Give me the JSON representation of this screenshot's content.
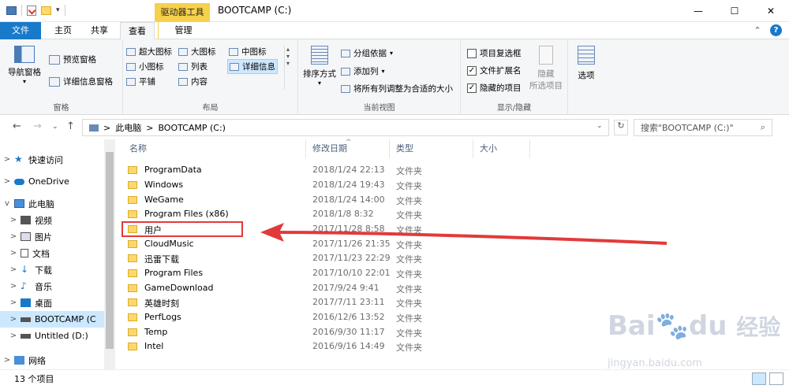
{
  "titlebar": {
    "context_tab": "驱动器工具",
    "title": "BOOTCAMP (C:)",
    "minimize": "—",
    "maximize": "☐",
    "close": "✕"
  },
  "tabs": {
    "file": "文件",
    "home": "主页",
    "share": "共享",
    "view": "查看",
    "manage": "管理",
    "collapse": "⌃",
    "help": "?"
  },
  "ribbon": {
    "panes": {
      "nav_pane": "导航窗格",
      "preview_pane": "预览窗格",
      "details_pane": "详细信息窗格",
      "label": "窗格"
    },
    "layout": {
      "xl_icons": "超大图标",
      "large_icons": "大图标",
      "medium_icons": "中图标",
      "small_icons": "小图标",
      "list": "列表",
      "details": "详细信息",
      "tiles": "平铺",
      "content": "内容",
      "label": "布局"
    },
    "current_view": {
      "sort_by": "排序方式",
      "group_by": "分组依据",
      "add_column": "添加列",
      "fit_columns": "将所有列调整为合适的大小",
      "label": "当前视图"
    },
    "show_hide": {
      "item_checkbox": "项目复选框",
      "item_checkbox_checked": false,
      "file_ext": "文件扩展名",
      "file_ext_checked": true,
      "hidden_items": "隐藏的项目",
      "hidden_items_checked": true,
      "hide_selected_1": "隐藏",
      "hide_selected_2": "所选项目",
      "label": "显示/隐藏"
    },
    "options": "选项"
  },
  "address": {
    "segments": [
      "此电脑",
      "BOOTCAMP (C:)"
    ],
    "sep": ">",
    "search_placeholder": "搜索\"BOOTCAMP (C:)\""
  },
  "nav": {
    "items": [
      {
        "label": "快速访问",
        "level": 0,
        "expander": ">"
      },
      {
        "label": "OneDrive",
        "level": 0,
        "expander": ">"
      },
      {
        "label": "此电脑",
        "level": 0,
        "expander": "v"
      },
      {
        "label": "视频",
        "level": 1,
        "expander": ">"
      },
      {
        "label": "图片",
        "level": 1,
        "expander": ">"
      },
      {
        "label": "文档",
        "level": 1,
        "expander": ">"
      },
      {
        "label": "下载",
        "level": 1,
        "expander": ">"
      },
      {
        "label": "音乐",
        "level": 1,
        "expander": ">"
      },
      {
        "label": "桌面",
        "level": 1,
        "expander": ">"
      },
      {
        "label": "BOOTCAMP (C",
        "level": 1,
        "expander": ">",
        "selected": true
      },
      {
        "label": "Untitled (D:)",
        "level": 1,
        "expander": ">"
      },
      {
        "label": "网络",
        "level": 0,
        "expander": ">"
      }
    ]
  },
  "columns": {
    "name": "名称",
    "date": "修改日期",
    "type": "类型",
    "size": "大小",
    "sort_indicator": "^"
  },
  "files": [
    {
      "name": "ProgramData",
      "date": "2018/1/24 22:13",
      "type": "文件夹"
    },
    {
      "name": "Windows",
      "date": "2018/1/24 19:43",
      "type": "文件夹"
    },
    {
      "name": "WeGame",
      "date": "2018/1/24 14:00",
      "type": "文件夹"
    },
    {
      "name": "Program Files (x86)",
      "date": "2018/1/8 8:32",
      "type": "文件夹"
    },
    {
      "name": "用户",
      "date": "2017/11/28 8:58",
      "type": "文件夹"
    },
    {
      "name": "CloudMusic",
      "date": "2017/11/26 21:35",
      "type": "文件夹"
    },
    {
      "name": "迅雷下载",
      "date": "2017/11/23 22:29",
      "type": "文件夹"
    },
    {
      "name": "Program Files",
      "date": "2017/10/10 22:01",
      "type": "文件夹"
    },
    {
      "name": "GameDownload",
      "date": "2017/9/24 9:41",
      "type": "文件夹"
    },
    {
      "name": "英雄时刻",
      "date": "2017/7/11 23:11",
      "type": "文件夹"
    },
    {
      "name": "PerfLogs",
      "date": "2016/12/6 13:52",
      "type": "文件夹"
    },
    {
      "name": "Temp",
      "date": "2016/9/30 11:17",
      "type": "文件夹"
    },
    {
      "name": "Intel",
      "date": "2016/9/16 14:49",
      "type": "文件夹"
    }
  ],
  "status": {
    "count": "13 个项目"
  },
  "watermark": {
    "brand": "Bai",
    "brand2": "du",
    "cn": "经验",
    "url": "jingyan.baidu.com"
  },
  "colors": {
    "file_tab": "#1979ca",
    "context_tab": "#f6d14b",
    "selection": "#cce8ff",
    "annotation": "#e23a3a",
    "folder": "#ffd86b"
  }
}
